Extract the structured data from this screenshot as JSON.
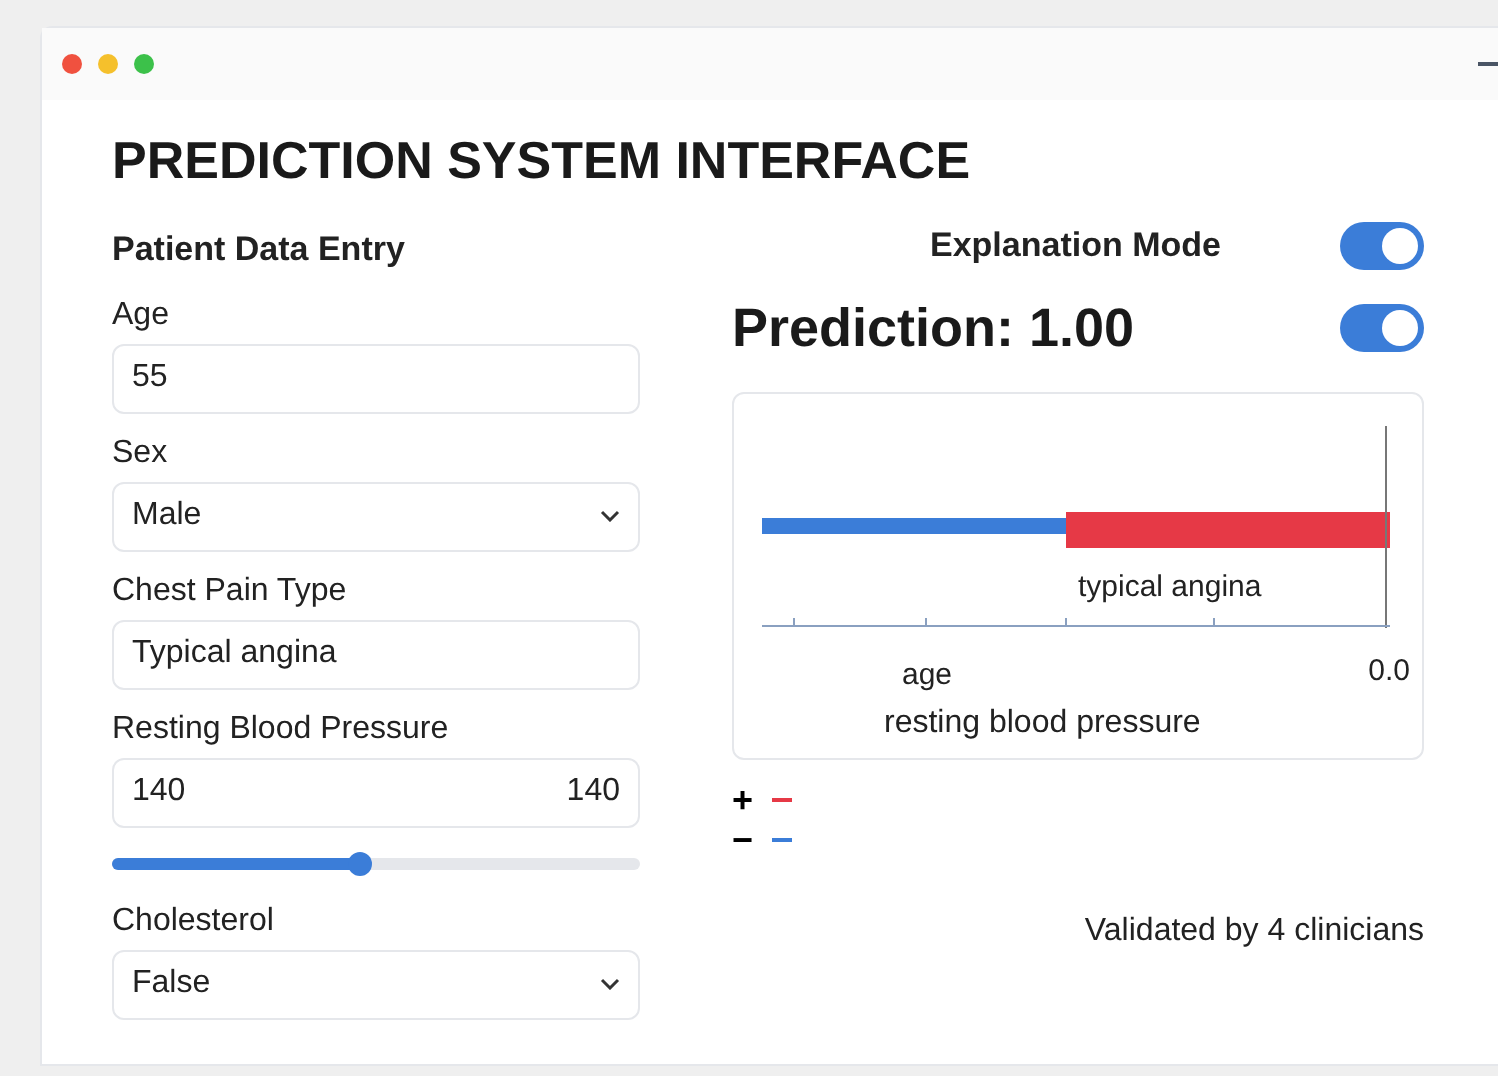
{
  "window": {
    "title": "PREDICTION SYSTEM INTERFACE"
  },
  "entry": {
    "heading": "Patient Data Entry",
    "fields": [
      {
        "kind": "text",
        "label": "Age",
        "value": "55"
      },
      {
        "kind": "select",
        "label": "Sex",
        "value": "Male"
      },
      {
        "kind": "text",
        "label": "Chest Pain Type",
        "value": "Typical angina"
      },
      {
        "kind": "slider",
        "label": "Resting Blood Pressure",
        "value": "140",
        "reading": "140",
        "level": 0.47
      },
      {
        "kind": "select",
        "label": "Cholesterol",
        "value": "False"
      }
    ]
  },
  "explanation": {
    "label": "Explanation Mode",
    "on": true
  },
  "prediction": {
    "label": "Prediction: 1.00",
    "on": true
  },
  "chart": {
    "bar_label": "typical angina",
    "axis_label": "age",
    "end_tick": "0.0",
    "xlabel": "resting blood pressure"
  },
  "legend": [
    {
      "sign": "+",
      "color": "#e63946"
    },
    {
      "sign": "−",
      "color": "#3b7dd8"
    }
  ],
  "footer": "Validated by 4 clinicians"
}
